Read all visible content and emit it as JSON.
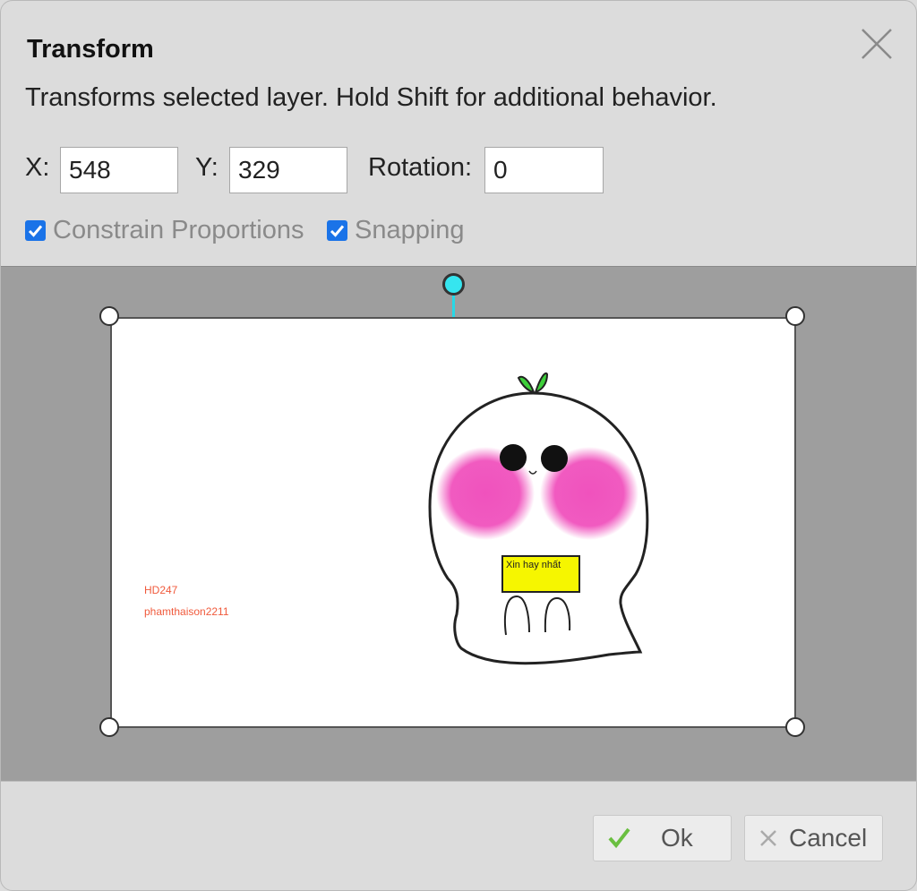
{
  "dialog": {
    "title": "Transform",
    "description": "Transforms selected layer. Hold Shift for additional behavior."
  },
  "fields": {
    "x_label": "X:",
    "x_value": "548",
    "y_label": "Y:",
    "y_value": "329",
    "rotation_label": "Rotation:",
    "rotation_value": "0"
  },
  "options": {
    "constrain_label": "Constrain Proportions",
    "constrain_checked": true,
    "snapping_label": "Snapping",
    "snapping_checked": true
  },
  "layer": {
    "text_line1": "HD247",
    "text_line2": "phamthaison2211",
    "sign_text": "Xin hay nhất"
  },
  "buttons": {
    "ok_label": "Ok",
    "cancel_label": "Cancel"
  },
  "colors": {
    "accent": "#1a73e8",
    "rotate_handle": "#36e5ef",
    "ok_check": "#6abf40",
    "layer_text": "#f05a3c",
    "blush": "#f052bd",
    "sign": "#f6f600"
  },
  "icons": [
    "close-icon",
    "checkmark-icon",
    "x-icon"
  ]
}
